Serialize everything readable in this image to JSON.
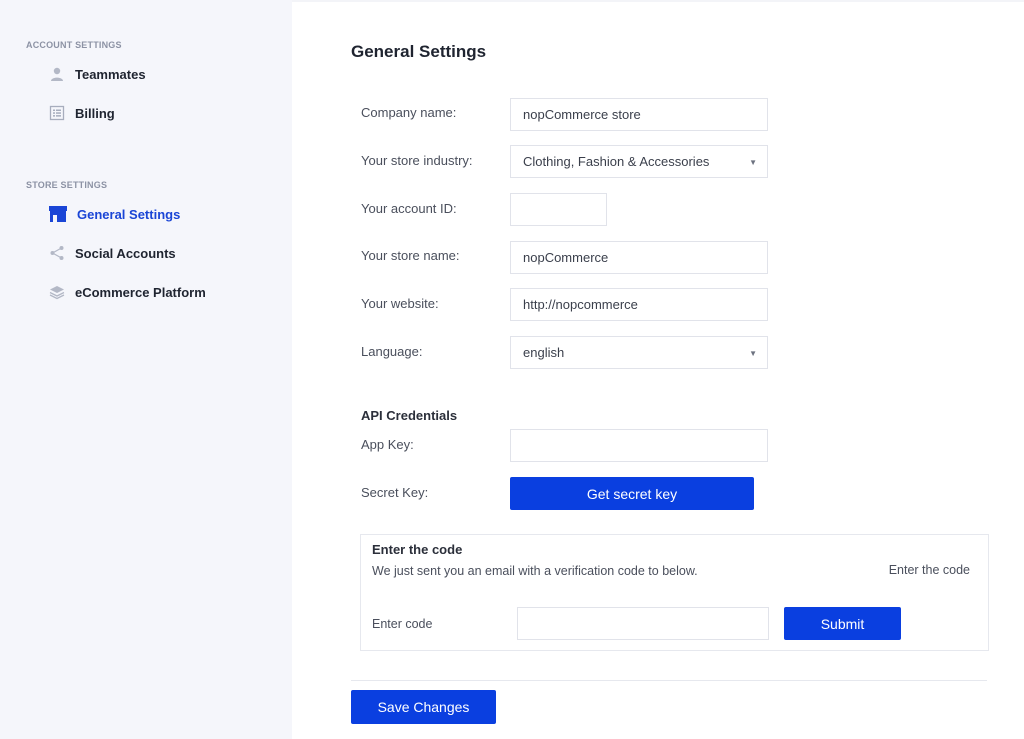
{
  "sidebar": {
    "account_section": "ACCOUNT SETTINGS",
    "store_section": "STORE SETTINGS",
    "items": [
      {
        "label": "Teammates",
        "icon": "user-icon"
      },
      {
        "label": "Billing",
        "icon": "billing-icon"
      },
      {
        "label": "General Settings",
        "icon": "store-icon",
        "active": true
      },
      {
        "label": "Social Accounts",
        "icon": "share-icon"
      },
      {
        "label": "eCommerce Platform",
        "icon": "layers-icon"
      }
    ]
  },
  "main": {
    "title": "General Settings",
    "fields": {
      "company_name": {
        "label": "Company name:",
        "value": "nopCommerce store"
      },
      "industry": {
        "label": "Your store industry:",
        "value": "Clothing, Fashion & Accessories"
      },
      "account_id": {
        "label": "Your account ID:",
        "value": ""
      },
      "store_name": {
        "label": "Your store name:",
        "value": "nopCommerce"
      },
      "website": {
        "label": "Your website:",
        "value": "http://nopcommerce"
      },
      "language": {
        "label": "Language:",
        "value": "english"
      }
    },
    "api": {
      "heading": "API Credentials",
      "app_key_label": "App Key:",
      "app_key_value": "",
      "secret_key_label": "Secret Key:",
      "get_secret_button": "Get secret key"
    },
    "code": {
      "title": "Enter the code",
      "description": "We just sent you an email with a verification code to below.",
      "hint": "Enter the code",
      "input_label": "Enter code",
      "input_value": "",
      "submit_button": "Submit"
    },
    "save_button": "Save Changes"
  },
  "colors": {
    "accent": "#0a3fe0",
    "active_link": "#1a45d6",
    "sidebar_bg": "#f5f6fb"
  }
}
